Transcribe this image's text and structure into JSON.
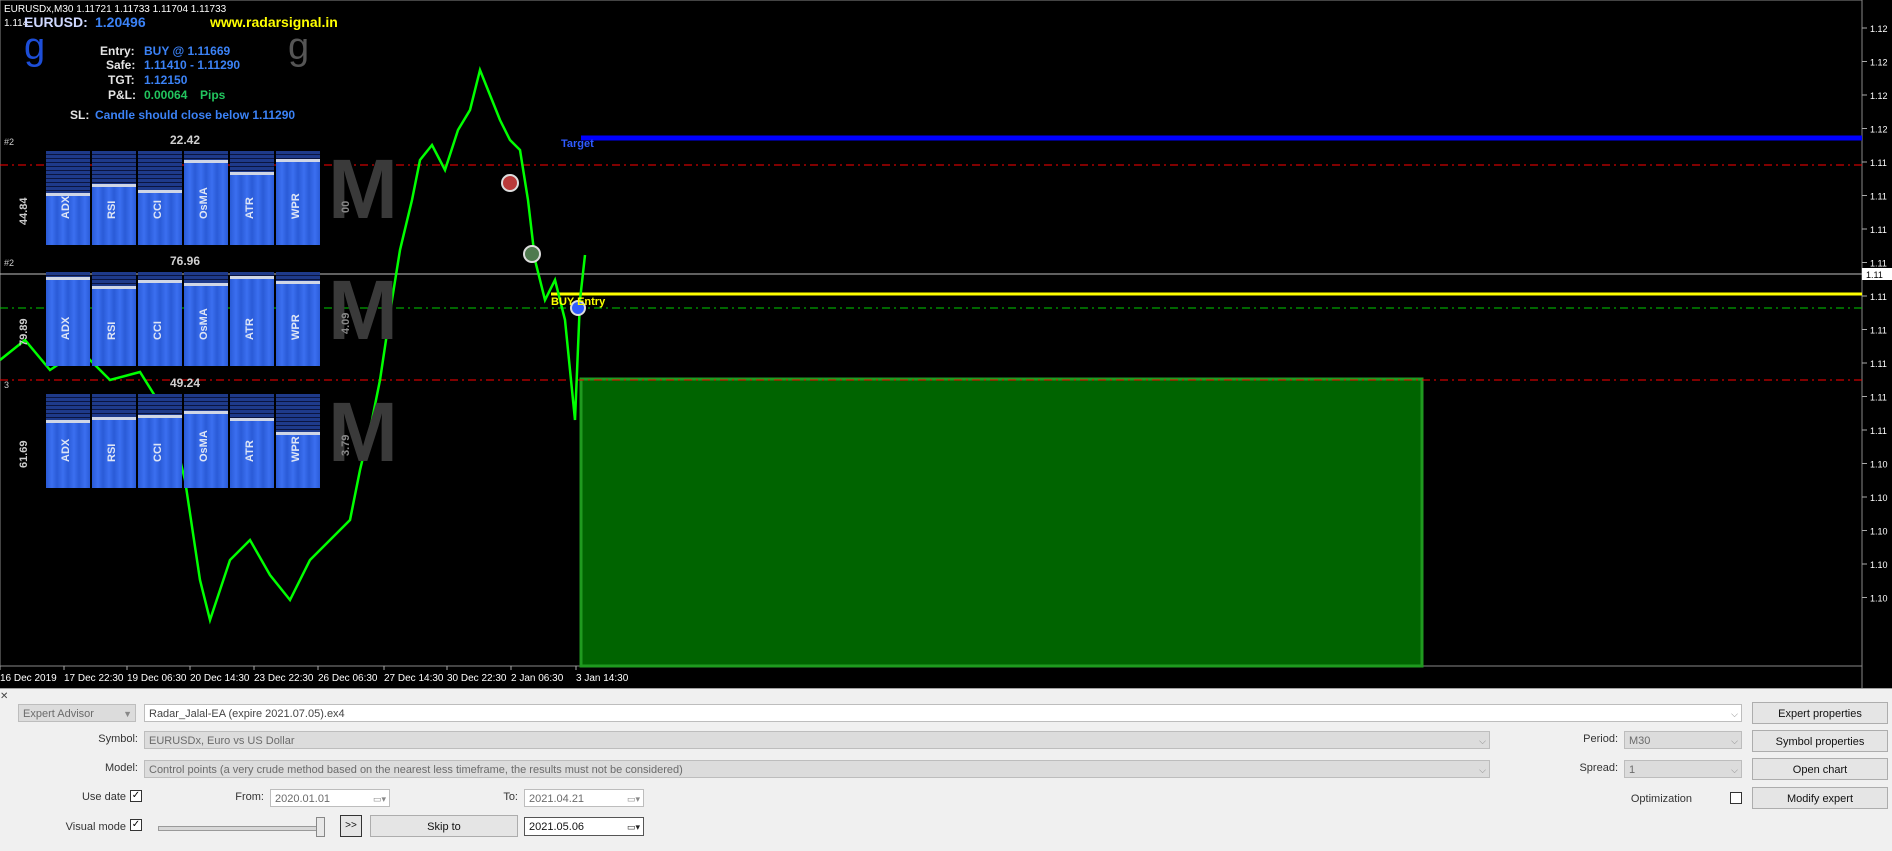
{
  "chart": {
    "header_line1": "EURUSDx,M30  1.11721 1.11733 1.11704 1.11733",
    "header_line2": "1.114",
    "pair_label": "EURUSD:",
    "pair_price": "1.20496",
    "website": "www.radarsignal.in",
    "logo_left": "g",
    "logo_right": "g",
    "info": {
      "entry_label": "Entry:",
      "entry_value": "BUY @ 1.11669",
      "safe_label": "Safe:",
      "safe_value": "1.11410 - 1.11290",
      "tgt_label": "TGT:",
      "tgt_value": "1.12150",
      "pl_label": "P&L:",
      "pl_value": "0.00064",
      "pl_unit": "Pips",
      "sl_label": "SL:",
      "sl_value": "Candle should close below 1.11290"
    },
    "target_label": "Target",
    "buy_entry_label": "BUY Entry",
    "panels": [
      {
        "marker": "#2",
        "side": "44.84",
        "top": "22.42",
        "right": "00",
        "big": "M",
        "labels": [
          "ADX",
          "RSI",
          "CCI",
          "OsMA",
          "ATR",
          "WPR"
        ],
        "levels": [
          0.55,
          0.65,
          0.58,
          0.9,
          0.78,
          0.92
        ]
      },
      {
        "marker": "#2",
        "side": "79.89",
        "top": "76.96",
        "right": "4.09",
        "big": "M",
        "labels": [
          "ADX",
          "RSI",
          "CCI",
          "OsMA",
          "ATR",
          "WPR"
        ],
        "levels": [
          0.95,
          0.85,
          0.92,
          0.88,
          0.96,
          0.9
        ]
      },
      {
        "marker": "3",
        "side": "61.69",
        "top": "49.24",
        "right": "3.79",
        "big": "M",
        "labels": [
          "ADX",
          "RSI",
          "CCI",
          "OsMA",
          "ATR",
          "WPR"
        ],
        "levels": [
          0.72,
          0.75,
          0.78,
          0.82,
          0.74,
          0.6
        ]
      }
    ],
    "x_ticks": [
      "16 Dec 2019",
      "17 Dec 22:30",
      "19 Dec 06:30",
      "20 Dec 14:30",
      "23 Dec 22:30",
      "26 Dec 06:30",
      "27 Dec 14:30",
      "30 Dec 22:30",
      "2 Jan 06:30",
      "3 Jan 14:30"
    ],
    "y_ticks": [
      "1.12",
      "1.12",
      "1.12",
      "1.12",
      "1.11",
      "1.11",
      "1.11",
      "1.11",
      "1.11",
      "1.11",
      "1.11",
      "1.11",
      "1.11",
      "1.10",
      "1.10",
      "1.10",
      "1.10",
      "1.10"
    ],
    "price_tag": "1.11",
    "colors": {
      "candles": "#00ff00",
      "target_line": "#0000ff",
      "entry_line": "#ffff00",
      "sl_line": "#ff0000",
      "safe_line": "#00cc00",
      "box": "#006400",
      "info_blue": "#3b82f6",
      "website": "#ffff00"
    }
  },
  "tester": {
    "type_select": "Expert Advisor",
    "expert_file": "Radar_Jalal-EA (expire 2021.07.05).ex4",
    "expert_properties": "Expert properties",
    "symbol_label": "Symbol:",
    "symbol_value": "EURUSDx, Euro vs US Dollar",
    "period_label": "Period:",
    "period_value": "M30",
    "symbol_properties": "Symbol properties",
    "model_label": "Model:",
    "model_value": "Control points (a very crude method based on the nearest less timeframe, the results must not be considered)",
    "spread_label": "Spread:",
    "spread_value": "1",
    "open_chart": "Open chart",
    "use_date_label": "Use date",
    "from_label": "From:",
    "from_value": "2020.01.01",
    "to_label": "To:",
    "to_value": "2021.04.21",
    "optimization_label": "Optimization",
    "modify_expert": "Modify expert",
    "visual_mode_label": "Visual mode",
    "skip_button": ">>",
    "skip_to": "Skip to",
    "skip_date": "2021.05.06"
  }
}
